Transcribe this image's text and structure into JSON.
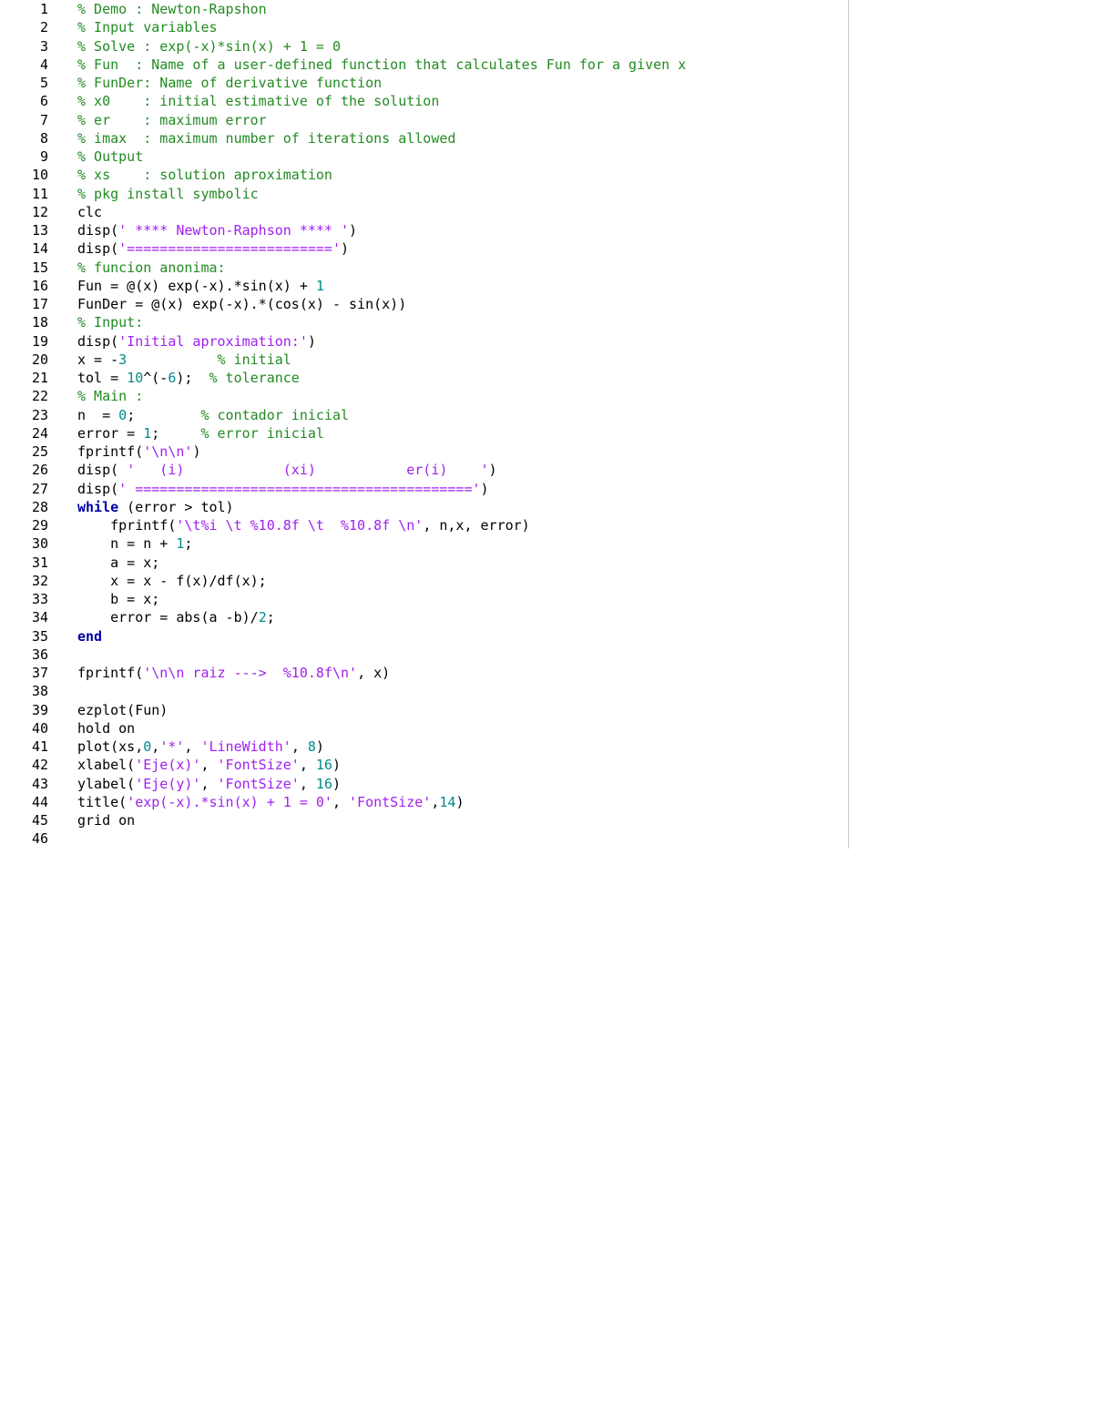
{
  "editor": {
    "lines": [
      {
        "n": "1",
        "tokens": [
          {
            "c": "c",
            "t": "% Demo : Newton-Rapshon"
          }
        ]
      },
      {
        "n": "2",
        "tokens": [
          {
            "c": "c",
            "t": "% Input variables"
          }
        ]
      },
      {
        "n": "3",
        "tokens": [
          {
            "c": "c",
            "t": "% Solve : exp(-x)*sin(x) + 1 = 0"
          }
        ]
      },
      {
        "n": "4",
        "tokens": [
          {
            "c": "c",
            "t": "% Fun  : Name of a user-defined function that calculates Fun for a given x"
          }
        ]
      },
      {
        "n": "5",
        "tokens": [
          {
            "c": "c",
            "t": "% FunDer: Name of derivative function"
          }
        ]
      },
      {
        "n": "6",
        "tokens": [
          {
            "c": "c",
            "t": "% x0    : initial estimative of the solution"
          }
        ]
      },
      {
        "n": "7",
        "tokens": [
          {
            "c": "c",
            "t": "% er    : maximum error"
          }
        ]
      },
      {
        "n": "8",
        "tokens": [
          {
            "c": "c",
            "t": "% imax  : maximum number of iterations allowed"
          }
        ]
      },
      {
        "n": "9",
        "tokens": [
          {
            "c": "c",
            "t": "% Output"
          }
        ]
      },
      {
        "n": "10",
        "tokens": [
          {
            "c": "c",
            "t": "% xs    : solution aproximation"
          }
        ]
      },
      {
        "n": "11",
        "tokens": [
          {
            "c": "c",
            "t": "% pkg install symbolic"
          }
        ]
      },
      {
        "n": "12",
        "tokens": [
          {
            "c": "p",
            "t": "clc"
          }
        ]
      },
      {
        "n": "13",
        "tokens": [
          {
            "c": "p",
            "t": "disp("
          },
          {
            "c": "s",
            "t": "' **** Newton-Raphson **** '"
          },
          {
            "c": "p",
            "t": ")"
          }
        ]
      },
      {
        "n": "14",
        "tokens": [
          {
            "c": "p",
            "t": "disp("
          },
          {
            "c": "s",
            "t": "'========================='"
          },
          {
            "c": "p",
            "t": ")"
          }
        ]
      },
      {
        "n": "15",
        "tokens": [
          {
            "c": "c",
            "t": "% funcion anonima:"
          }
        ]
      },
      {
        "n": "16",
        "tokens": [
          {
            "c": "p",
            "t": "Fun = @(x) exp(-x).*sin(x) + "
          },
          {
            "c": "n",
            "t": "1"
          }
        ]
      },
      {
        "n": "17",
        "tokens": [
          {
            "c": "p",
            "t": "FunDer = @(x) exp(-x).*(cos(x) - sin(x))"
          }
        ]
      },
      {
        "n": "18",
        "tokens": [
          {
            "c": "c",
            "t": "% Input:"
          }
        ]
      },
      {
        "n": "19",
        "tokens": [
          {
            "c": "p",
            "t": "disp("
          },
          {
            "c": "s",
            "t": "'Initial aproximation:'"
          },
          {
            "c": "p",
            "t": ")"
          }
        ]
      },
      {
        "n": "20",
        "tokens": [
          {
            "c": "p",
            "t": "x = -"
          },
          {
            "c": "n",
            "t": "3"
          },
          {
            "c": "p",
            "t": "           "
          },
          {
            "c": "c",
            "t": "% initial"
          }
        ]
      },
      {
        "n": "21",
        "tokens": [
          {
            "c": "p",
            "t": "tol = "
          },
          {
            "c": "n",
            "t": "10"
          },
          {
            "c": "p",
            "t": "^(-"
          },
          {
            "c": "n",
            "t": "6"
          },
          {
            "c": "p",
            "t": ");  "
          },
          {
            "c": "c",
            "t": "% tolerance"
          }
        ]
      },
      {
        "n": "22",
        "tokens": [
          {
            "c": "c",
            "t": "% Main :"
          }
        ]
      },
      {
        "n": "23",
        "tokens": [
          {
            "c": "p",
            "t": "n  = "
          },
          {
            "c": "n",
            "t": "0"
          },
          {
            "c": "p",
            "t": ";        "
          },
          {
            "c": "c",
            "t": "% contador inicial"
          }
        ]
      },
      {
        "n": "24",
        "tokens": [
          {
            "c": "p",
            "t": "error = "
          },
          {
            "c": "n",
            "t": "1"
          },
          {
            "c": "p",
            "t": ";     "
          },
          {
            "c": "c",
            "t": "% error inicial"
          }
        ]
      },
      {
        "n": "25",
        "tokens": [
          {
            "c": "p",
            "t": "fprintf("
          },
          {
            "c": "s",
            "t": "'\\n\\n'"
          },
          {
            "c": "p",
            "t": ")"
          }
        ]
      },
      {
        "n": "26",
        "tokens": [
          {
            "c": "p",
            "t": "disp( "
          },
          {
            "c": "s",
            "t": "'   (i)            (xi)           er(i)    '"
          },
          {
            "c": "p",
            "t": ")"
          }
        ]
      },
      {
        "n": "27",
        "tokens": [
          {
            "c": "p",
            "t": "disp("
          },
          {
            "c": "s",
            "t": "' ========================================='"
          },
          {
            "c": "p",
            "t": ")"
          }
        ]
      },
      {
        "n": "28",
        "tokens": [
          {
            "c": "k",
            "t": "while"
          },
          {
            "c": "p",
            "t": " (error > tol)"
          }
        ]
      },
      {
        "n": "29",
        "tokens": [
          {
            "c": "p",
            "t": "    fprintf("
          },
          {
            "c": "s",
            "t": "'\\t%i \\t %10.8f \\t  %10.8f \\n'"
          },
          {
            "c": "p",
            "t": ", n,x, error)"
          }
        ]
      },
      {
        "n": "30",
        "tokens": [
          {
            "c": "p",
            "t": "    n = n + "
          },
          {
            "c": "n",
            "t": "1"
          },
          {
            "c": "p",
            "t": ";"
          }
        ]
      },
      {
        "n": "31",
        "tokens": [
          {
            "c": "p",
            "t": "    a = x;"
          }
        ]
      },
      {
        "n": "32",
        "tokens": [
          {
            "c": "p",
            "t": "    x = x - f(x)/df(x);"
          }
        ]
      },
      {
        "n": "33",
        "tokens": [
          {
            "c": "p",
            "t": "    b = x;"
          }
        ]
      },
      {
        "n": "34",
        "tokens": [
          {
            "c": "p",
            "t": "    error = abs(a -b)/"
          },
          {
            "c": "n",
            "t": "2"
          },
          {
            "c": "p",
            "t": ";"
          }
        ]
      },
      {
        "n": "35",
        "tokens": [
          {
            "c": "k",
            "t": "end"
          }
        ]
      },
      {
        "n": "36",
        "tokens": []
      },
      {
        "n": "37",
        "tokens": [
          {
            "c": "p",
            "t": "fprintf("
          },
          {
            "c": "s",
            "t": "'\\n\\n raiz --->  %10.8f\\n'"
          },
          {
            "c": "p",
            "t": ", x)"
          }
        ]
      },
      {
        "n": "38",
        "tokens": []
      },
      {
        "n": "39",
        "tokens": [
          {
            "c": "p",
            "t": "ezplot(Fun)"
          }
        ]
      },
      {
        "n": "40",
        "tokens": [
          {
            "c": "p",
            "t": "hold on"
          }
        ]
      },
      {
        "n": "41",
        "tokens": [
          {
            "c": "p",
            "t": "plot(xs,"
          },
          {
            "c": "n",
            "t": "0"
          },
          {
            "c": "p",
            "t": ","
          },
          {
            "c": "s",
            "t": "'*'"
          },
          {
            "c": "p",
            "t": ", "
          },
          {
            "c": "s",
            "t": "'LineWidth'"
          },
          {
            "c": "p",
            "t": ", "
          },
          {
            "c": "n",
            "t": "8"
          },
          {
            "c": "p",
            "t": ")"
          }
        ]
      },
      {
        "n": "42",
        "tokens": [
          {
            "c": "p",
            "t": "xlabel("
          },
          {
            "c": "s",
            "t": "'Eje(x)'"
          },
          {
            "c": "p",
            "t": ", "
          },
          {
            "c": "s",
            "t": "'FontSize'"
          },
          {
            "c": "p",
            "t": ", "
          },
          {
            "c": "n",
            "t": "16"
          },
          {
            "c": "p",
            "t": ")"
          }
        ]
      },
      {
        "n": "43",
        "tokens": [
          {
            "c": "p",
            "t": "ylabel("
          },
          {
            "c": "s",
            "t": "'Eje(y)'"
          },
          {
            "c": "p",
            "t": ", "
          },
          {
            "c": "s",
            "t": "'FontSize'"
          },
          {
            "c": "p",
            "t": ", "
          },
          {
            "c": "n",
            "t": "16"
          },
          {
            "c": "p",
            "t": ")"
          }
        ]
      },
      {
        "n": "44",
        "tokens": [
          {
            "c": "p",
            "t": "title("
          },
          {
            "c": "s",
            "t": "'exp(-x).*sin(x) + 1 = 0'"
          },
          {
            "c": "p",
            "t": ", "
          },
          {
            "c": "s",
            "t": "'FontSize'"
          },
          {
            "c": "p",
            "t": ","
          },
          {
            "c": "n",
            "t": "14"
          },
          {
            "c": "p",
            "t": ")"
          }
        ]
      },
      {
        "n": "45",
        "tokens": [
          {
            "c": "p",
            "t": "grid on"
          }
        ]
      },
      {
        "n": "46",
        "tokens": []
      }
    ]
  },
  "colors": {
    "comment": "#228b22",
    "string": "#a020f0",
    "number": "#008b8b",
    "keyword": "#0000a0",
    "plain": "#000000",
    "background": "#ffffff",
    "margin_line": "#c8c8c8"
  }
}
